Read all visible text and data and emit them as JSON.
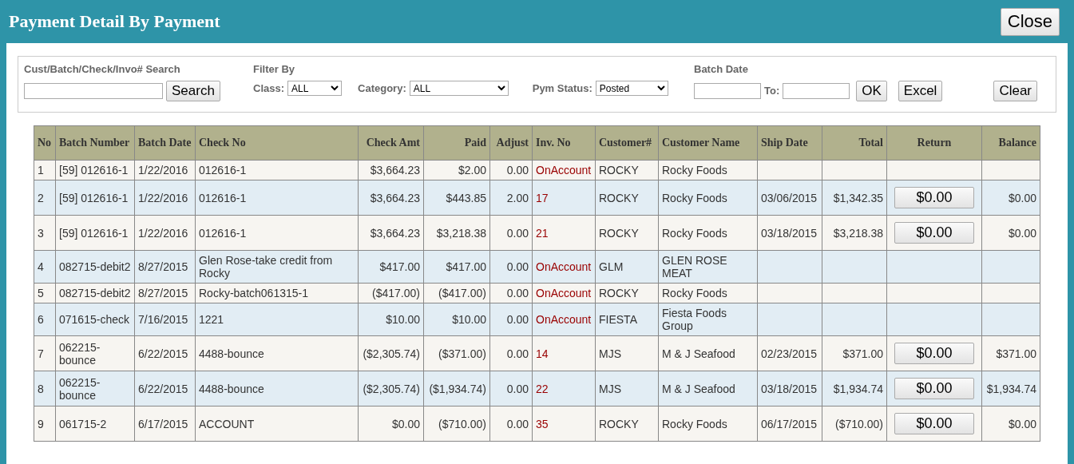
{
  "window": {
    "title": "Payment Detail By Payment",
    "close_button": "Close"
  },
  "filters": {
    "search_label": "Cust/Batch/Check/Invo# Search",
    "search_button": "Search",
    "filter_by_label": "Filter By",
    "class_label": "Class:",
    "class_value": "ALL",
    "category_label": "Category:",
    "category_value": "ALL",
    "status_label": "Pym Status:",
    "status_value": "Posted",
    "batch_date_label": "Batch Date",
    "to_label": "To:",
    "ok_button": "OK",
    "excel_button": "Excel",
    "clear_button": "Clear"
  },
  "table": {
    "columns": [
      "No",
      "Batch Number",
      "Batch Date",
      "Check No",
      "Check Amt",
      "Paid",
      "Adjust",
      "Inv. No",
      "Customer#",
      "Customer Name",
      "Ship Date",
      "Total",
      "Return",
      "Balance"
    ],
    "rows": [
      {
        "no": "1",
        "batch_number": "[59] 012616-1",
        "batch_date": "1/22/2016",
        "check_no": "012616-1",
        "check_amt": "$3,664.23",
        "paid": "$2.00",
        "adjust": "0.00",
        "inv_no": "OnAccount",
        "customer": "ROCKY",
        "customer_name": "Rocky Foods"
      },
      {
        "no": "2",
        "batch_number": "[59] 012616-1",
        "batch_date": "1/22/2016",
        "check_no": "012616-1",
        "check_amt": "$3,664.23",
        "paid": "$443.85",
        "adjust": "2.00",
        "inv_no": "17",
        "customer": "ROCKY",
        "customer_name": "Rocky Foods",
        "ship_date": "03/06/2015",
        "total": "$1,342.35",
        "return": "$0.00",
        "balance": "$0.00"
      },
      {
        "no": "3",
        "batch_number": "[59] 012616-1",
        "batch_date": "1/22/2016",
        "check_no": "012616-1",
        "check_amt": "$3,664.23",
        "paid": "$3,218.38",
        "adjust": "0.00",
        "inv_no": "21",
        "customer": "ROCKY",
        "customer_name": "Rocky Foods",
        "ship_date": "03/18/2015",
        "total": "$3,218.38",
        "return": "$0.00",
        "balance": "$0.00"
      },
      {
        "no": "4",
        "batch_number": "082715-debit2",
        "batch_date": "8/27/2015",
        "check_no": "Glen Rose-take credit from Rocky",
        "check_amt": "$417.00",
        "paid": "$417.00",
        "adjust": "0.00",
        "inv_no": "OnAccount",
        "customer": "GLM",
        "customer_name": "GLEN ROSE MEAT"
      },
      {
        "no": "5",
        "batch_number": "082715-debit2",
        "batch_date": "8/27/2015",
        "check_no": "Rocky-batch061315-1",
        "check_amt": "($417.00)",
        "paid": "($417.00)",
        "adjust": "0.00",
        "inv_no": "OnAccount",
        "customer": "ROCKY",
        "customer_name": "Rocky Foods"
      },
      {
        "no": "6",
        "batch_number": "071615-check",
        "batch_date": "7/16/2015",
        "check_no": "1221",
        "check_amt": "$10.00",
        "paid": "$10.00",
        "adjust": "0.00",
        "inv_no": "OnAccount",
        "customer": "FIESTA",
        "customer_name": "Fiesta Foods Group"
      },
      {
        "no": "7",
        "batch_number": "062215-bounce",
        "batch_date": "6/22/2015",
        "check_no": "4488-bounce",
        "check_amt": "($2,305.74)",
        "paid": "($371.00)",
        "adjust": "0.00",
        "inv_no": "14",
        "customer": "MJS",
        "customer_name": "M & J Seafood",
        "ship_date": "02/23/2015",
        "total": "$371.00",
        "return": "$0.00",
        "balance": "$371.00"
      },
      {
        "no": "8",
        "batch_number": "062215-bounce",
        "batch_date": "6/22/2015",
        "check_no": "4488-bounce",
        "check_amt": "($2,305.74)",
        "paid": "($1,934.74)",
        "adjust": "0.00",
        "inv_no": "22",
        "customer": "MJS",
        "customer_name": "M & J Seafood",
        "ship_date": "03/18/2015",
        "total": "$1,934.74",
        "return": "$0.00",
        "balance": "$1,934.74"
      },
      {
        "no": "9",
        "batch_number": "061715-2",
        "batch_date": "6/17/2015",
        "check_no": "ACCOUNT",
        "check_amt": "$0.00",
        "paid": "($710.00)",
        "adjust": "0.00",
        "inv_no": "35",
        "customer": "ROCKY",
        "customer_name": "Rocky Foods",
        "ship_date": "06/17/2015",
        "total": "($710.00)",
        "return": "$0.00",
        "balance": "$0.00"
      }
    ]
  }
}
